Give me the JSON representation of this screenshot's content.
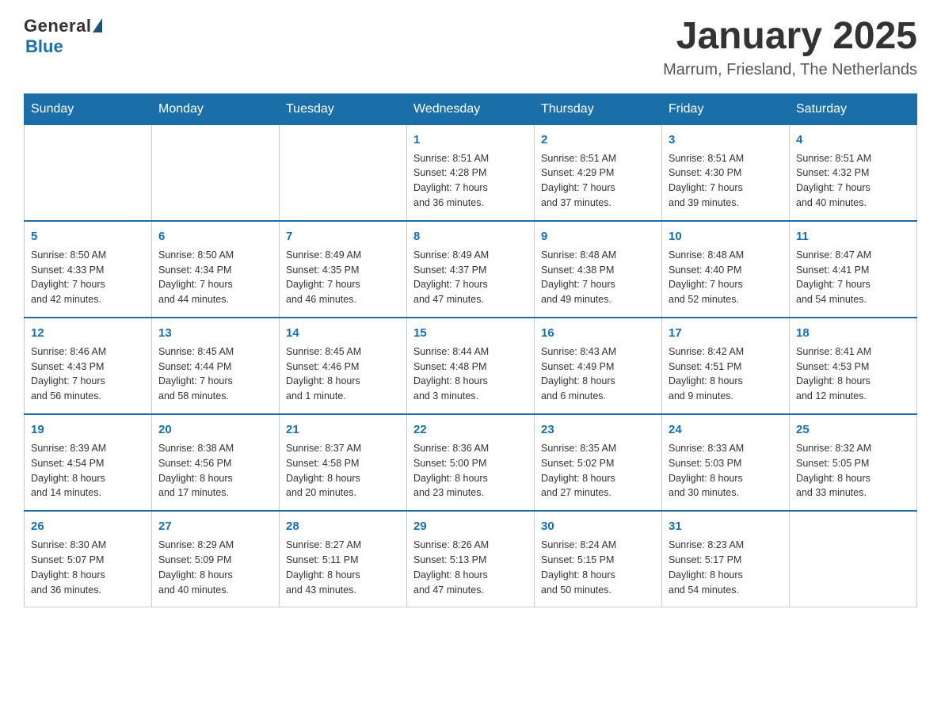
{
  "logo": {
    "general": "General",
    "blue": "Blue"
  },
  "title": "January 2025",
  "location": "Marrum, Friesland, The Netherlands",
  "days_of_week": [
    "Sunday",
    "Monday",
    "Tuesday",
    "Wednesday",
    "Thursday",
    "Friday",
    "Saturday"
  ],
  "weeks": [
    [
      {
        "day": "",
        "info": ""
      },
      {
        "day": "",
        "info": ""
      },
      {
        "day": "",
        "info": ""
      },
      {
        "day": "1",
        "info": "Sunrise: 8:51 AM\nSunset: 4:28 PM\nDaylight: 7 hours\nand 36 minutes."
      },
      {
        "day": "2",
        "info": "Sunrise: 8:51 AM\nSunset: 4:29 PM\nDaylight: 7 hours\nand 37 minutes."
      },
      {
        "day": "3",
        "info": "Sunrise: 8:51 AM\nSunset: 4:30 PM\nDaylight: 7 hours\nand 39 minutes."
      },
      {
        "day": "4",
        "info": "Sunrise: 8:51 AM\nSunset: 4:32 PM\nDaylight: 7 hours\nand 40 minutes."
      }
    ],
    [
      {
        "day": "5",
        "info": "Sunrise: 8:50 AM\nSunset: 4:33 PM\nDaylight: 7 hours\nand 42 minutes."
      },
      {
        "day": "6",
        "info": "Sunrise: 8:50 AM\nSunset: 4:34 PM\nDaylight: 7 hours\nand 44 minutes."
      },
      {
        "day": "7",
        "info": "Sunrise: 8:49 AM\nSunset: 4:35 PM\nDaylight: 7 hours\nand 46 minutes."
      },
      {
        "day": "8",
        "info": "Sunrise: 8:49 AM\nSunset: 4:37 PM\nDaylight: 7 hours\nand 47 minutes."
      },
      {
        "day": "9",
        "info": "Sunrise: 8:48 AM\nSunset: 4:38 PM\nDaylight: 7 hours\nand 49 minutes."
      },
      {
        "day": "10",
        "info": "Sunrise: 8:48 AM\nSunset: 4:40 PM\nDaylight: 7 hours\nand 52 minutes."
      },
      {
        "day": "11",
        "info": "Sunrise: 8:47 AM\nSunset: 4:41 PM\nDaylight: 7 hours\nand 54 minutes."
      }
    ],
    [
      {
        "day": "12",
        "info": "Sunrise: 8:46 AM\nSunset: 4:43 PM\nDaylight: 7 hours\nand 56 minutes."
      },
      {
        "day": "13",
        "info": "Sunrise: 8:45 AM\nSunset: 4:44 PM\nDaylight: 7 hours\nand 58 minutes."
      },
      {
        "day": "14",
        "info": "Sunrise: 8:45 AM\nSunset: 4:46 PM\nDaylight: 8 hours\nand 1 minute."
      },
      {
        "day": "15",
        "info": "Sunrise: 8:44 AM\nSunset: 4:48 PM\nDaylight: 8 hours\nand 3 minutes."
      },
      {
        "day": "16",
        "info": "Sunrise: 8:43 AM\nSunset: 4:49 PM\nDaylight: 8 hours\nand 6 minutes."
      },
      {
        "day": "17",
        "info": "Sunrise: 8:42 AM\nSunset: 4:51 PM\nDaylight: 8 hours\nand 9 minutes."
      },
      {
        "day": "18",
        "info": "Sunrise: 8:41 AM\nSunset: 4:53 PM\nDaylight: 8 hours\nand 12 minutes."
      }
    ],
    [
      {
        "day": "19",
        "info": "Sunrise: 8:39 AM\nSunset: 4:54 PM\nDaylight: 8 hours\nand 14 minutes."
      },
      {
        "day": "20",
        "info": "Sunrise: 8:38 AM\nSunset: 4:56 PM\nDaylight: 8 hours\nand 17 minutes."
      },
      {
        "day": "21",
        "info": "Sunrise: 8:37 AM\nSunset: 4:58 PM\nDaylight: 8 hours\nand 20 minutes."
      },
      {
        "day": "22",
        "info": "Sunrise: 8:36 AM\nSunset: 5:00 PM\nDaylight: 8 hours\nand 23 minutes."
      },
      {
        "day": "23",
        "info": "Sunrise: 8:35 AM\nSunset: 5:02 PM\nDaylight: 8 hours\nand 27 minutes."
      },
      {
        "day": "24",
        "info": "Sunrise: 8:33 AM\nSunset: 5:03 PM\nDaylight: 8 hours\nand 30 minutes."
      },
      {
        "day": "25",
        "info": "Sunrise: 8:32 AM\nSunset: 5:05 PM\nDaylight: 8 hours\nand 33 minutes."
      }
    ],
    [
      {
        "day": "26",
        "info": "Sunrise: 8:30 AM\nSunset: 5:07 PM\nDaylight: 8 hours\nand 36 minutes."
      },
      {
        "day": "27",
        "info": "Sunrise: 8:29 AM\nSunset: 5:09 PM\nDaylight: 8 hours\nand 40 minutes."
      },
      {
        "day": "28",
        "info": "Sunrise: 8:27 AM\nSunset: 5:11 PM\nDaylight: 8 hours\nand 43 minutes."
      },
      {
        "day": "29",
        "info": "Sunrise: 8:26 AM\nSunset: 5:13 PM\nDaylight: 8 hours\nand 47 minutes."
      },
      {
        "day": "30",
        "info": "Sunrise: 8:24 AM\nSunset: 5:15 PM\nDaylight: 8 hours\nand 50 minutes."
      },
      {
        "day": "31",
        "info": "Sunrise: 8:23 AM\nSunset: 5:17 PM\nDaylight: 8 hours\nand 54 minutes."
      },
      {
        "day": "",
        "info": ""
      }
    ]
  ]
}
